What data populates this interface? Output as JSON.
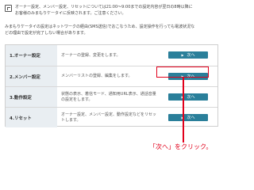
{
  "notice": {
    "line1": "オーナー設定、メンバー設定、リセットについては21:00～9:00までの設定内容が翌日の8時以降に",
    "line2": "お客様のみまもりケータイに反映されます。ご注意ください。"
  },
  "sub": {
    "line1": "みまもりケータイの設定はネットワークの経由(SMS送信)でおこなうため、設定操作を行っても電波状況な",
    "line2": "どの理由で設定が完了しない場合があります。"
  },
  "rows": [
    {
      "label": "1.オーナー設定",
      "desc": "オーナーの登録、変更をします。",
      "button": "次へ"
    },
    {
      "label": "2.メンバー設定",
      "desc": "メンバーリストの登録、編集をします。",
      "button": "次へ"
    },
    {
      "label": "3.動作設定",
      "desc": "状態の表示、着信モード、通知用URL表示、通話音量の設定をします。",
      "button": "次へ"
    },
    {
      "label": "4.リセット",
      "desc": "オーナー設定、メンバー設定、動作設定などをリセットします。",
      "button": "次へ"
    }
  ],
  "callout": "「次へ」をクリック。",
  "colors": {
    "button": "#2a7f9a",
    "highlight": "#e1001b",
    "label_bg": "#e9eef2"
  }
}
